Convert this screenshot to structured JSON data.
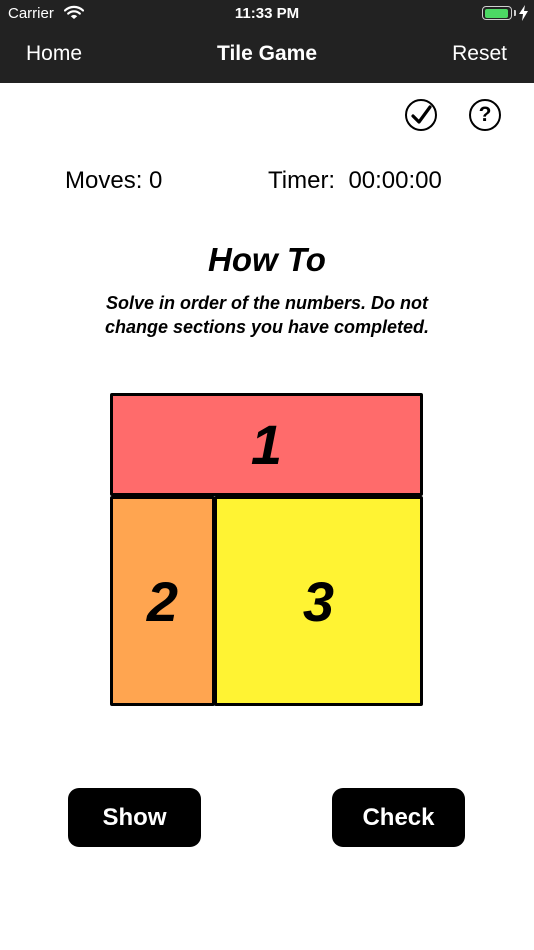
{
  "status_bar": {
    "carrier": "Carrier",
    "time": "11:33 PM",
    "battery_level": 0.95
  },
  "nav": {
    "back_label": "Home",
    "title": "Tile Game",
    "reset_label": "Reset"
  },
  "toolbar": {
    "check_icon": "checkmark-circle-icon",
    "help_label": "?"
  },
  "stats": {
    "moves": "Moves: 0",
    "timer": "Timer:  00:00:00"
  },
  "howto": {
    "title": "How To",
    "line1": "Solve in order of the numbers. Do not",
    "line2": "change sections you have completed."
  },
  "tiles": [
    {
      "label": "1",
      "color": "#ff6b6b"
    },
    {
      "label": "2",
      "color": "#ffa550"
    },
    {
      "label": "3",
      "color": "#fff333"
    }
  ],
  "buttons": {
    "show": "Show",
    "check": "Check"
  },
  "colors": {
    "bar_bg": "#222222",
    "battery_green": "#4cd964",
    "button_bg": "#000000"
  }
}
